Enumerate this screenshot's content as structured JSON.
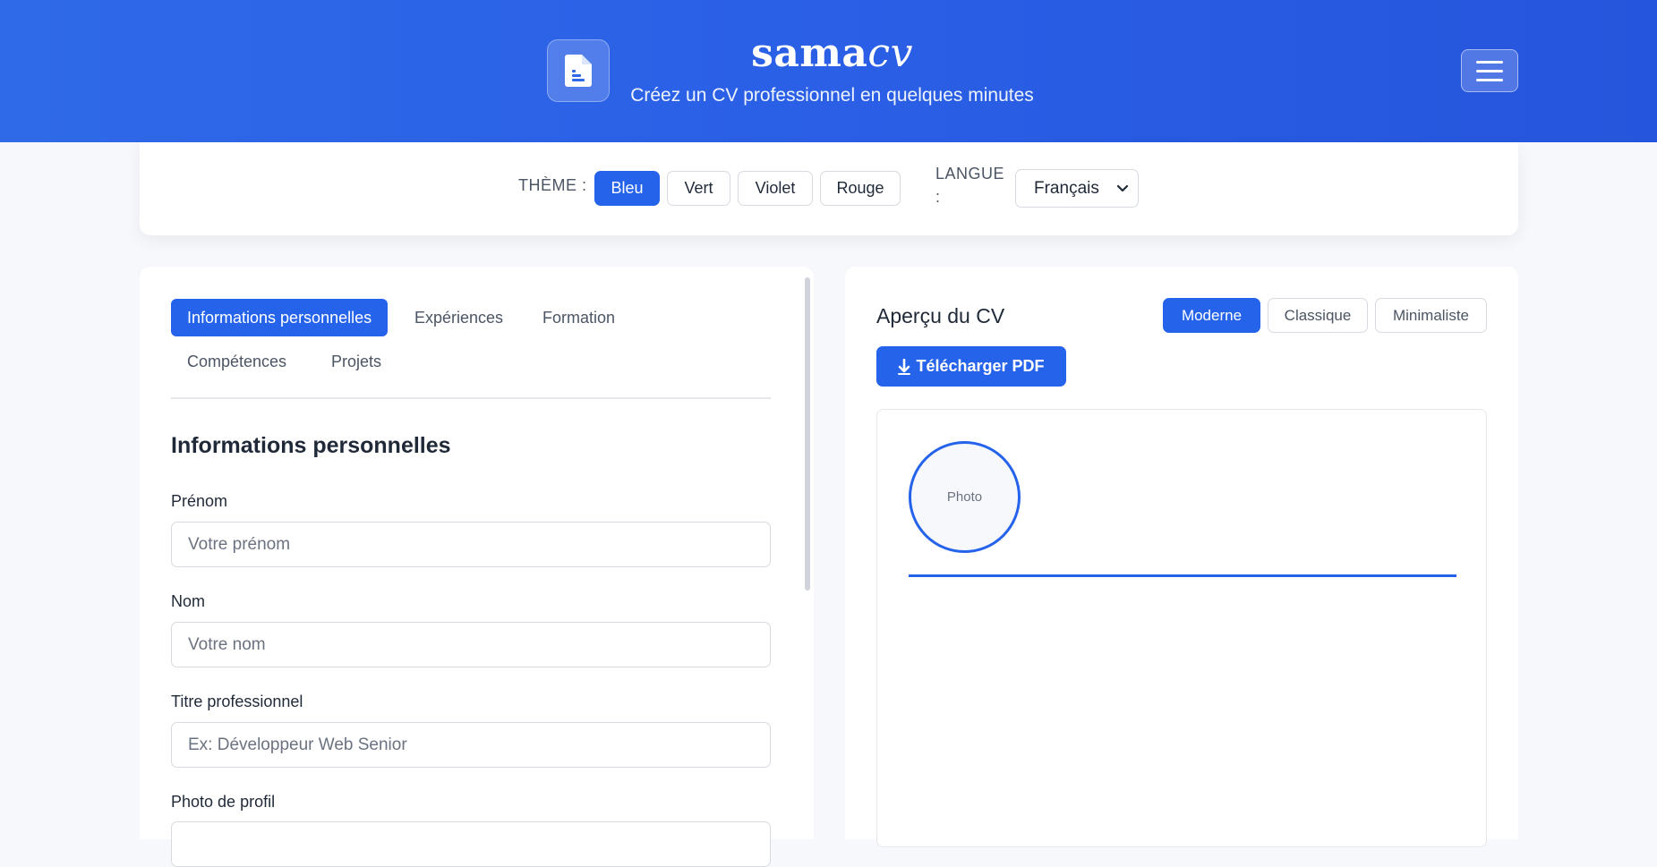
{
  "header": {
    "brand_main": "sama",
    "brand_accent": "cv",
    "tagline": "Créez un CV professionnel en quelques minutes",
    "logo_icon": "document-icon",
    "menu_icon": "hamburger-menu-icon"
  },
  "toolbar": {
    "theme_label": "THÈME :",
    "themes": [
      "Bleu",
      "Vert",
      "Violet",
      "Rouge"
    ],
    "active_theme": "Bleu",
    "language_label_line1": "LANGUE",
    "language_label_line2": ":",
    "language_selected": "Français"
  },
  "editor": {
    "tabs": [
      "Informations personnelles",
      "Expériences",
      "Formation",
      "Compétences",
      "Projets"
    ],
    "active_tab": "Informations personnelles",
    "section_title": "Informations personnelles",
    "fields": {
      "first_name": {
        "label": "Prénom",
        "placeholder": "Votre prénom"
      },
      "last_name": {
        "label": "Nom",
        "placeholder": "Votre nom"
      },
      "job_title": {
        "label": "Titre professionnel",
        "placeholder": "Ex: Développeur Web Senior"
      },
      "photo_label": "Photo de profil"
    }
  },
  "preview": {
    "title": "Aperçu du CV",
    "templates": [
      "Moderne",
      "Classique",
      "Minimaliste"
    ],
    "active_template": "Moderne",
    "download_label": "Télécharger PDF",
    "photo_placeholder": "Photo"
  },
  "colors": {
    "primary": "#2563eb",
    "header_gradient_start": "#2f6ae8",
    "header_gradient_end": "#2555dc",
    "page_background": "#f7f8fb"
  }
}
